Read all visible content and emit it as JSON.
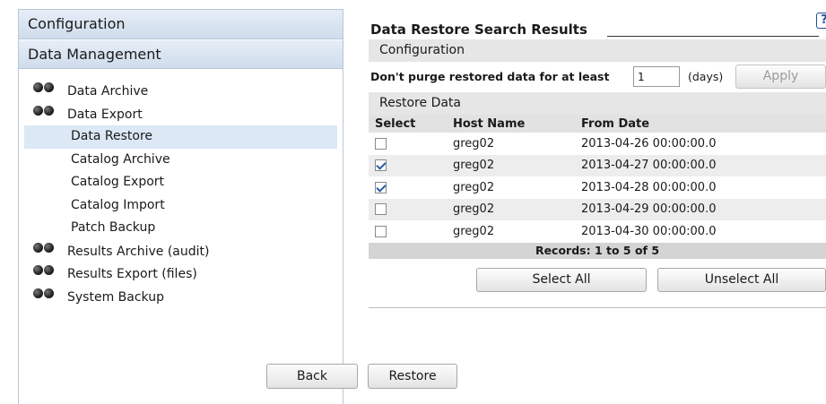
{
  "nav": {
    "header_configuration": "Configuration",
    "header_data_management": "Data Management",
    "items": [
      {
        "label": "Data Archive",
        "icon": "status-dots-icon"
      },
      {
        "label": "Data Export",
        "icon": "status-dots-icon"
      },
      {
        "label": "Data Restore",
        "selected": true
      },
      {
        "label": "Catalog Archive"
      },
      {
        "label": "Catalog Export"
      },
      {
        "label": "Catalog Import"
      },
      {
        "label": "Patch Backup"
      },
      {
        "label": "Results Archive (audit)",
        "icon": "status-dots-icon"
      },
      {
        "label": "Results Export (files)",
        "icon": "status-dots-icon"
      },
      {
        "label": "System Backup",
        "icon": "status-dots-icon"
      }
    ]
  },
  "main": {
    "title": "Data Restore Search Results",
    "help_icon": "?",
    "configuration_section": "Configuration",
    "purge_label": "Don't purge restored data for at least",
    "purge_value": "1",
    "days_label": "(days)",
    "apply_label": "Apply",
    "restore_section": "Restore Data",
    "table": {
      "columns": [
        "Select",
        "Host Name",
        "From Date"
      ],
      "rows": [
        {
          "checked": false,
          "host": "greg02",
          "from_date": "2013-04-26 00:00:00.0"
        },
        {
          "checked": true,
          "host": "greg02",
          "from_date": "2013-04-27 00:00:00.0"
        },
        {
          "checked": true,
          "host": "greg02",
          "from_date": "2013-04-28 00:00:00.0"
        },
        {
          "checked": false,
          "host": "greg02",
          "from_date": "2013-04-29 00:00:00.0"
        },
        {
          "checked": false,
          "host": "greg02",
          "from_date": "2013-04-30 00:00:00.0"
        }
      ],
      "records": "Records: 1 to 5 of 5"
    },
    "select_all_label": "Select All",
    "unselect_all_label": "Unselect All",
    "back_label": "Back",
    "restore_label": "Restore"
  },
  "colors": {
    "nav_header_bg": "#cfdcec",
    "nav_selected_bg": "#dce8f6",
    "section_bar_bg": "#e6e6e6",
    "alt_row_bg": "#ededed",
    "help_blue": "#1b4f9c"
  }
}
